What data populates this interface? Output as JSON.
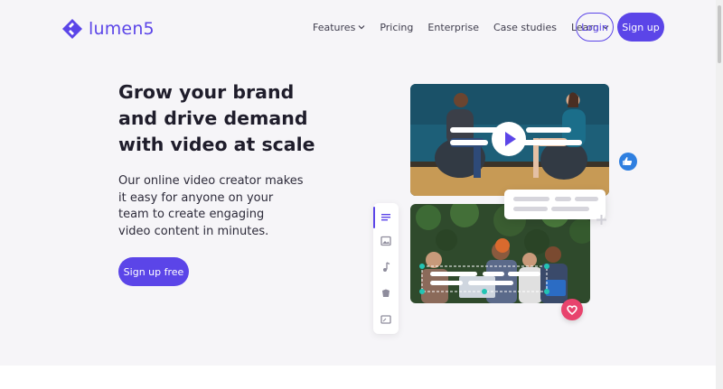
{
  "brand": {
    "name": "lumen5",
    "color": "#5b45e8"
  },
  "nav": {
    "items": [
      {
        "label": "Features",
        "dropdown": true
      },
      {
        "label": "Pricing",
        "dropdown": false
      },
      {
        "label": "Enterprise",
        "dropdown": false
      },
      {
        "label": "Case studies",
        "dropdown": false
      },
      {
        "label": "Learn",
        "dropdown": true
      }
    ],
    "login_label": "Login",
    "signup_label": "Sign up"
  },
  "hero": {
    "headline_lines": [
      "Grow your brand",
      "and drive demand",
      "with video at scale"
    ],
    "subtext_lines": [
      "Our online video creator makes",
      "it easy for anyone on your",
      "team to create engaging",
      "video content in minutes."
    ],
    "cta_label": "Sign up free"
  },
  "illustration": {
    "toolbar_icons": [
      "text-icon",
      "image-icon",
      "music-icon",
      "brand-icon",
      "resize-icon"
    ],
    "badges": [
      "thumbs-up-icon",
      "heart-icon",
      "plus-icon",
      "play-icon"
    ]
  }
}
